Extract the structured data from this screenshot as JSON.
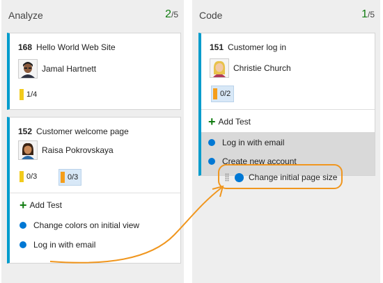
{
  "columns": [
    {
      "title": "Analyze",
      "count": "2",
      "limit": "/5",
      "cards": [
        {
          "id": "168",
          "title": "Hello World Web Site",
          "assignee": "Jamal Hartnett",
          "tasks": [
            {
              "label": "1/4"
            }
          ]
        },
        {
          "id": "152",
          "title": "Customer welcome page",
          "assignee": "Raisa Pokrovskaya",
          "tasks": [
            {
              "label": "0/3"
            },
            {
              "label": "0/3"
            }
          ],
          "add_test": "Add Test",
          "tests": [
            "Change colors on initial view",
            "Log in with email"
          ]
        }
      ]
    },
    {
      "title": "Code",
      "count": "1",
      "limit": "/5",
      "cards": [
        {
          "id": "151",
          "title": "Customer log in",
          "assignee": "Christie Church",
          "tasks": [
            {
              "label": "0/2"
            }
          ],
          "add_test": "Add Test",
          "tests": [
            "Log in with email",
            "Create new account"
          ]
        }
      ]
    }
  ],
  "drag_item": {
    "label": "Change initial page size"
  },
  "colors": {
    "card_accent": "#009ccc",
    "count_green": "#107c10",
    "task_yellow": "#f2cb1d",
    "task_orange": "#f59e1b",
    "test_dot": "#0078d4",
    "highlight": "#f0961e"
  }
}
